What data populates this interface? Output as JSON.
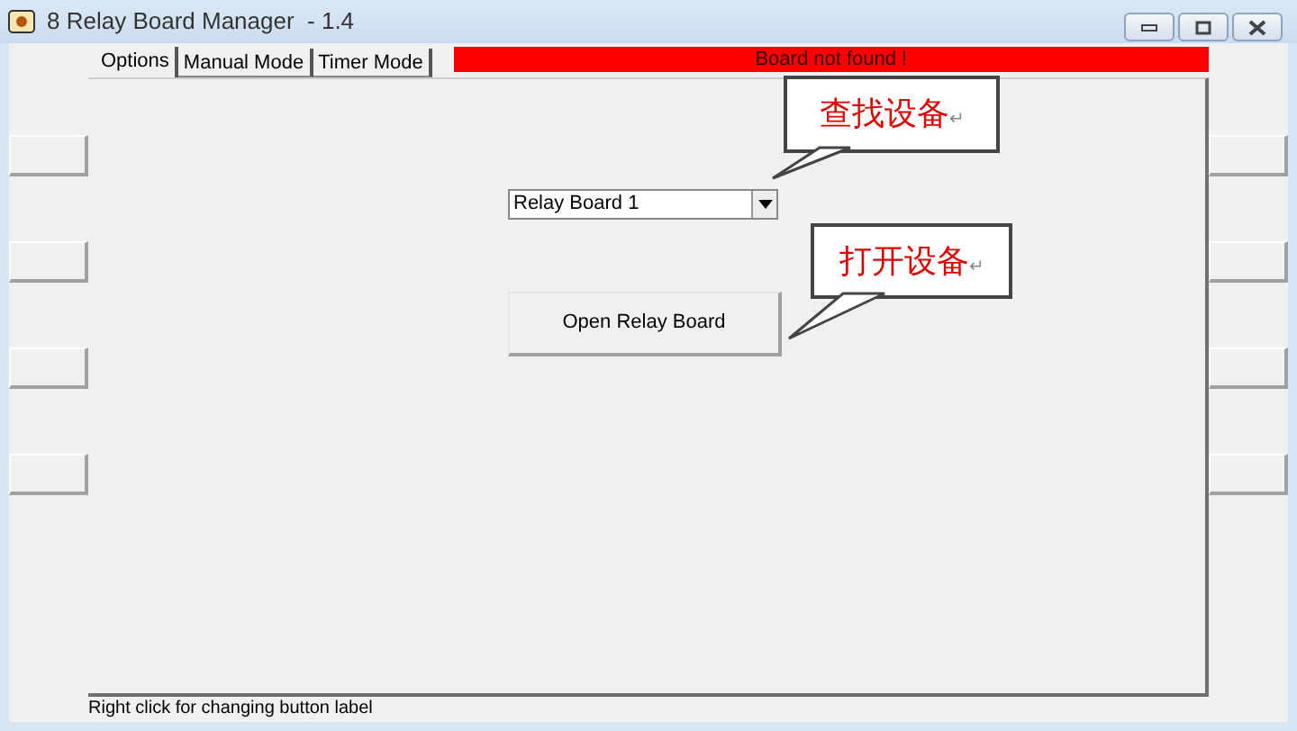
{
  "window": {
    "title": "8 Relay Board Manager  - 1.4"
  },
  "tabs": [
    {
      "label": "Options",
      "selected": true
    },
    {
      "label": "Manual Mode",
      "selected": false
    },
    {
      "label": "Timer Mode",
      "selected": false
    }
  ],
  "status_banner": {
    "text": "Board not found !"
  },
  "board_select": {
    "value": "Relay Board 1"
  },
  "open_button": {
    "label": "Open Relay Board"
  },
  "callouts": [
    {
      "text": "查找设备",
      "end_mark": "↵"
    },
    {
      "text": "打开设备",
      "end_mark": "↵"
    }
  ],
  "status_bar": {
    "text": "Right click for changing button label"
  }
}
